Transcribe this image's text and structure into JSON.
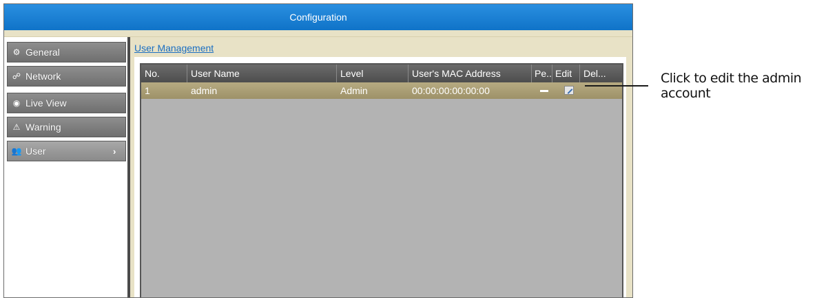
{
  "window": {
    "title": "Configuration"
  },
  "sidebar": {
    "items": [
      {
        "label": "General",
        "icon": "gear-icon"
      },
      {
        "label": "Network",
        "icon": "network-icon"
      },
      {
        "label": "Live View",
        "icon": "eye-icon"
      },
      {
        "label": "Warning",
        "icon": "warning-icon"
      },
      {
        "label": "User",
        "icon": "users-icon",
        "selected": true
      }
    ]
  },
  "main": {
    "section_title": "User Management",
    "table": {
      "columns": [
        "No.",
        "User Name",
        "Level",
        "User's MAC Address",
        "Pe..",
        "Edit",
        "Del..."
      ],
      "rows": [
        {
          "no": "1",
          "user_name": "admin",
          "level": "Admin",
          "mac": "00:00:00:00:00:00",
          "permission": "dash-icon",
          "edit": "edit-icon",
          "delete": ""
        }
      ]
    }
  },
  "callout": {
    "text": "Click to edit the admin account"
  },
  "colors": {
    "title_bar": "#1784d6",
    "sidebar_item": "#7f7f7f",
    "panel_bg": "#e8e2c6",
    "table_header": "#5a5a5a",
    "selected_row": "#aa9e74",
    "table_bg": "#b3b3b3",
    "link": "#1a6ec2"
  }
}
